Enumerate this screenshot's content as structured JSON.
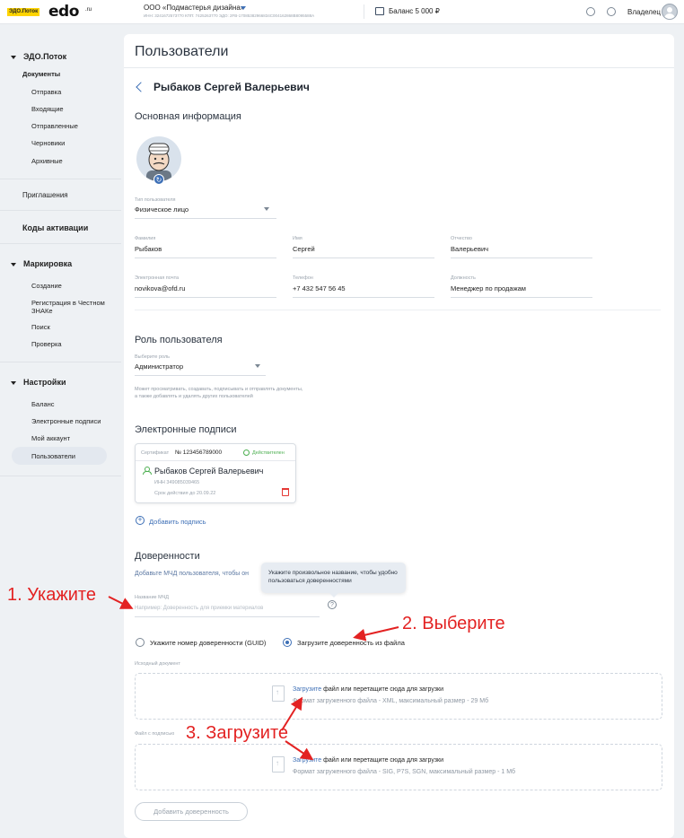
{
  "topbar": {
    "logo_badge": "ЭДО.Поток",
    "logo_text": "edo",
    "logo_suffix": ".ru",
    "org_name": "ООО «Подмастерья дизайна»",
    "org_ids": "ИНН: 3241672573770    КПП: 7425263770    ЭДО: 2FB-17085382966834C004162868B8095588A",
    "balance": "Баланс 5 000 ₽",
    "owner": "Владелец"
  },
  "sidebar": {
    "group_edo": "ЭДО.Поток",
    "documents": "Документы",
    "doc_items": [
      "Отправка",
      "Входящие",
      "Отправленные",
      "Черновики",
      "Архивные"
    ],
    "invitations": "Приглашения",
    "activation_codes": "Коды активации",
    "group_marking": "Маркировка",
    "marking_items": [
      "Создание",
      "Регистрация в Честном ЗНАКе",
      "Поиск",
      "Проверка"
    ],
    "group_settings": "Настройки",
    "settings_items": [
      "Баланс",
      "Электронные подписи",
      "Мой аккаунт",
      "Пользователи"
    ]
  },
  "page": {
    "title": "Пользователи",
    "user_name": "Рыбаков Сергей Валерьевич"
  },
  "basic_info": {
    "heading": "Основная информация",
    "user_type_label": "Тип пользователя",
    "user_type_value": "Физическое лицо",
    "last_name_label": "Фамилия",
    "last_name_value": "Рыбаков",
    "first_name_label": "Имя",
    "first_name_value": "Сергей",
    "patronymic_label": "Отчество",
    "patronymic_value": "Валерьевич",
    "email_label": "Электронная почта",
    "email_value": "novikova@ofd.ru",
    "phone_label": "Телефон",
    "phone_value": "+7 432 547 56 45",
    "position_label": "Должность",
    "position_value": "Менеджер по продажам"
  },
  "role": {
    "heading": "Роль пользователя",
    "select_label": "Выберите роль",
    "select_value": "Администратор",
    "hint_line1": "Может просматривать, создавать, подписывать и отправлять документы,",
    "hint_line2": "а также добавлять и удалять других пользователей"
  },
  "signatures": {
    "heading": "Электронные подписи",
    "cert_label": "Сертификат",
    "cert_number": "№ 123456789000",
    "status": "Действителен",
    "owner_name": "Рыбаков Сергей Валерьевич",
    "inn": "ИНН 349085039465",
    "valid_until": "Срок действия до 20.09.22",
    "add_label": "Добавить подпись"
  },
  "poa": {
    "heading": "Доверенности",
    "description": "Добавьте МЧД пользователя, чтобы он",
    "tooltip": "Укажите произвольное название, чтобы удобно пользоваться доверенностями",
    "name_label": "Название МЧД",
    "name_placeholder": "Например: Доверенность для приемки материалов",
    "radio_guid": "Укажите номер доверенности (GUID)",
    "radio_file": "Загрузите доверенность из файла",
    "source_doc_label": "Исходный документ",
    "upload_link": "Загрузите",
    "upload_text": " файл или перетащите сюда для загрузки",
    "source_formats": "Формат загруженного файла - XML, максимальный размер - 29 Мб",
    "signed_file_label": "Файл с подписью",
    "signed_formats": "Формат загруженного файла - SIG, P7S, SGN, максимальный размер - 1 Мб",
    "add_button": "Добавить доверенность"
  },
  "annotations": {
    "step1": "1. Укажите",
    "step2": "2. Выберите",
    "step3": "3. Загрузите",
    "color": "#e32222"
  }
}
